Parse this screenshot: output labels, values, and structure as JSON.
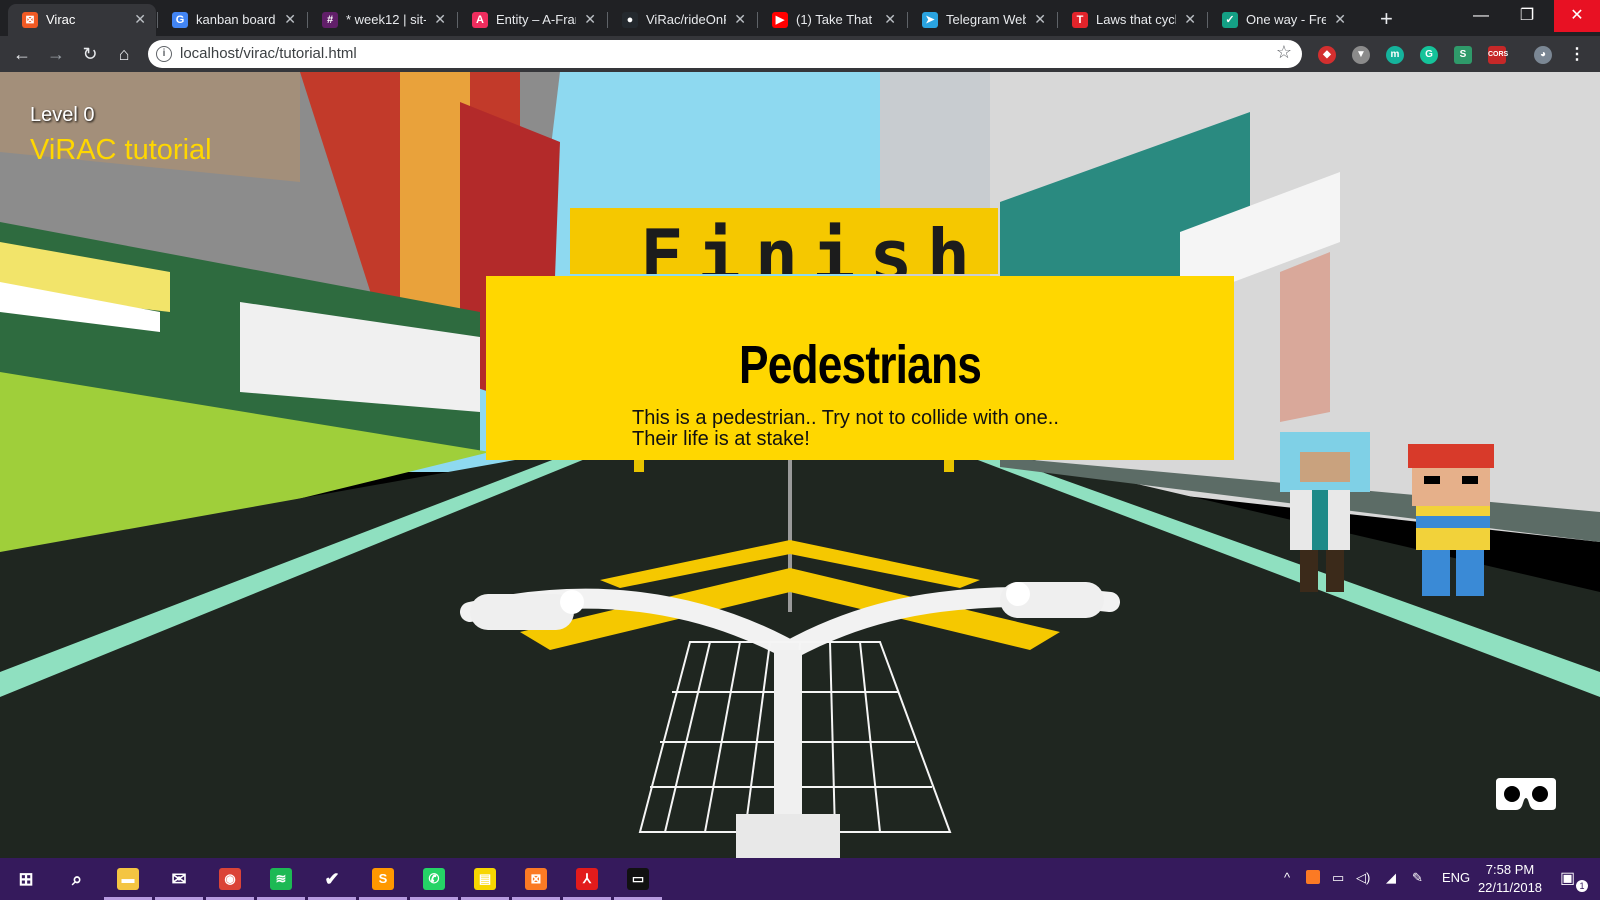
{
  "browser": {
    "tabs": [
      {
        "title": "Virac",
        "favicon": "virac-icon",
        "color": "#f15a24",
        "glyph": "⊠"
      },
      {
        "title": "kanban board",
        "favicon": "google-icon",
        "color": "#4285f4",
        "glyph": "G"
      },
      {
        "title": "* week12 | sit-i",
        "favicon": "slack-icon",
        "color": "#611f69",
        "glyph": "#"
      },
      {
        "title": "Entity – A-Fram",
        "favicon": "aframe-icon",
        "color": "#ef2d5e",
        "glyph": "A"
      },
      {
        "title": "ViRac/rideOnR",
        "favicon": "github-icon",
        "color": "#24292e",
        "glyph": "●"
      },
      {
        "title": "(1) Take That -",
        "favicon": "youtube-icon",
        "color": "#ff0000",
        "glyph": "▶"
      },
      {
        "title": "Telegram Web",
        "favicon": "telegram-icon",
        "color": "#2aa3e0",
        "glyph": "➤"
      },
      {
        "title": "Laws that cycli",
        "favicon": "t-icon",
        "color": "#e3242b",
        "glyph": "T"
      },
      {
        "title": "One way - Free",
        "favicon": "checkmark-icon",
        "color": "#14a085",
        "glyph": "✓"
      }
    ],
    "address": "localhost/virac/tutorial.html",
    "window_controls": {
      "minimize": "—",
      "maximize": "❐",
      "close": "✕"
    }
  },
  "hud": {
    "level": "Level 0",
    "title": "ViRAC tutorial"
  },
  "scene": {
    "finish_sign": "Finish",
    "panel": {
      "title": "Pedestrians",
      "line1": "This is a pedestrian.. Try not to collide with one..",
      "line2": "Their life is at stake!"
    }
  },
  "taskbar": {
    "apps": [
      {
        "name": "start",
        "color": "transparent",
        "glyph": "⊞"
      },
      {
        "name": "search",
        "color": "transparent",
        "glyph": "⌕"
      },
      {
        "name": "file-explorer",
        "color": "#f4c542",
        "glyph": "▬"
      },
      {
        "name": "mail",
        "color": "transparent",
        "glyph": "✉"
      },
      {
        "name": "chrome",
        "color": "#db4437",
        "glyph": "◉"
      },
      {
        "name": "spotify",
        "color": "#1db954",
        "glyph": "≋"
      },
      {
        "name": "todo",
        "color": "transparent",
        "glyph": "✔"
      },
      {
        "name": "sublime",
        "color": "#ff9800",
        "glyph": "S"
      },
      {
        "name": "whatsapp",
        "color": "#25d366",
        "glyph": "✆"
      },
      {
        "name": "sticky-notes",
        "color": "#f7d600",
        "glyph": "▤"
      },
      {
        "name": "xampp",
        "color": "#fb7a24",
        "glyph": "⊠"
      },
      {
        "name": "acrobat",
        "color": "#e21b1b",
        "glyph": "⅄"
      },
      {
        "name": "terminal",
        "color": "#111111",
        "glyph": "▭"
      }
    ],
    "tray": {
      "language": "ENG",
      "time": "7:58 PM",
      "date": "22/11/2018",
      "notifications": "1"
    }
  }
}
